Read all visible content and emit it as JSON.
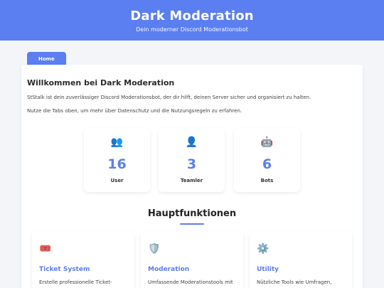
{
  "header": {
    "title": "Dark Moderation",
    "subtitle": "Dein moderner Discord Moderationsbot"
  },
  "tabs": [
    {
      "label": "Home",
      "active": true
    }
  ],
  "welcome": {
    "heading": "Willkommen bei Dark Moderation",
    "text1": "StStalk ist dein zuverlässiger Discord Moderationsbot, der dir hilft, deinen Server sicher und organisiert zu halten.",
    "text2": "Nutze die Tabs oben, um mehr über Datenschutz und die Nutzungsregeln zu erfahren."
  },
  "stats": [
    {
      "icon": "users-icon",
      "glyph": "👥",
      "value": "16",
      "label": "User"
    },
    {
      "icon": "person-icon",
      "glyph": "👤",
      "value": "3",
      "label": "Teamler"
    },
    {
      "icon": "robot-icon",
      "glyph": "🤖",
      "value": "6",
      "label": "Bots"
    }
  ],
  "features_title": "Hauptfunktionen",
  "features": [
    {
      "icon": "ticket-icon",
      "glyph": "🎟️",
      "title": "Ticket System",
      "desc": "Erstelle professionelle Ticket-"
    },
    {
      "icon": "shield-icon",
      "glyph": "🛡️",
      "title": "Moderation",
      "desc": "Umfassende Moderationstools mit"
    },
    {
      "icon": "gear-icon",
      "glyph": "⚙️",
      "title": "Utility",
      "desc": "Nützliche Tools wie Umfragen,"
    }
  ],
  "colors": {
    "accent": "#5b7ef0",
    "background": "#f3f5f9"
  }
}
